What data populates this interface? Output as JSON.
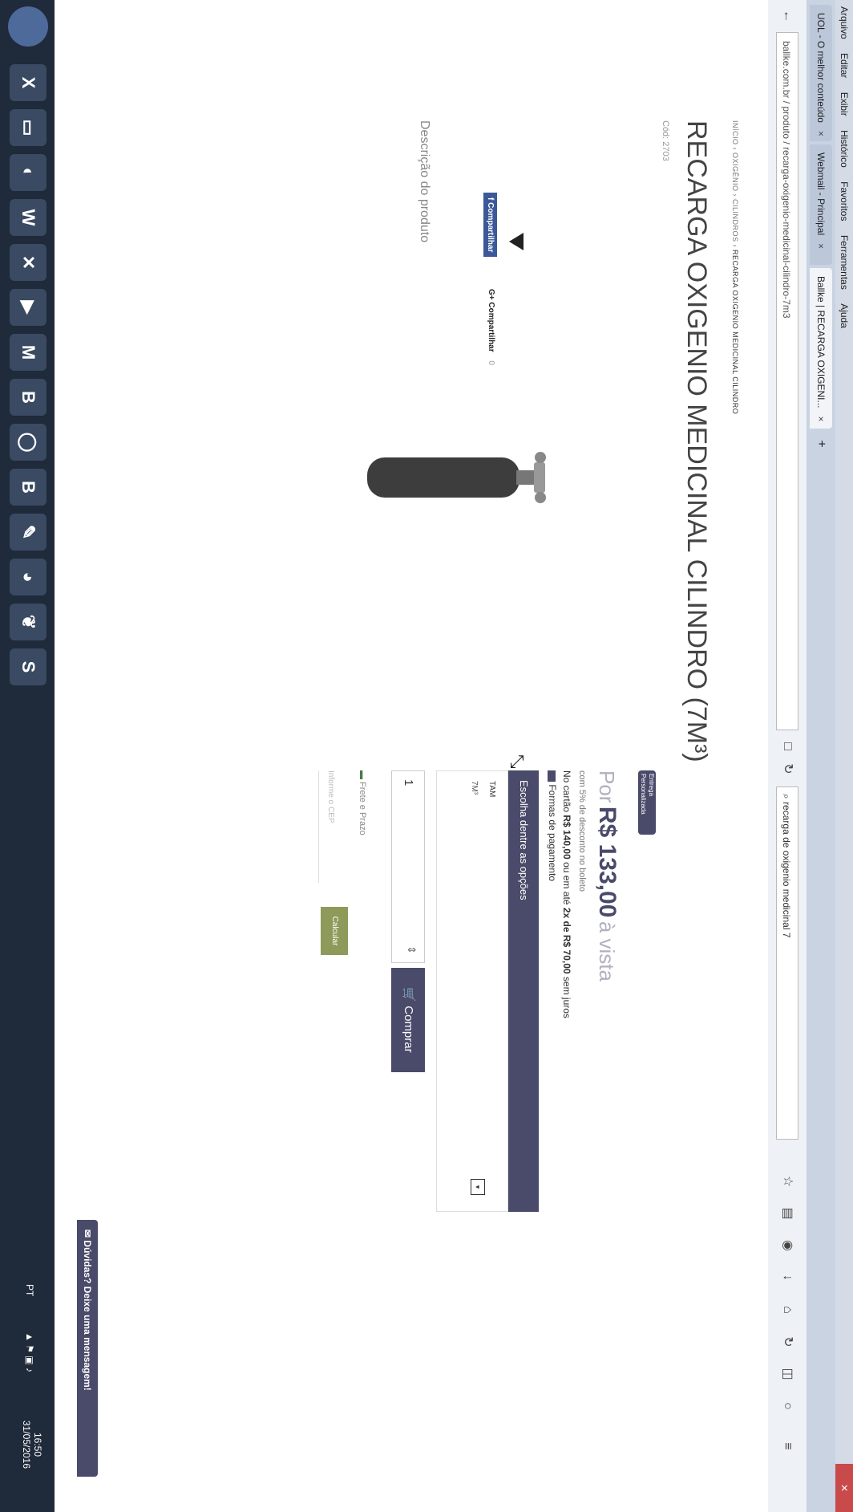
{
  "browser": {
    "menu": [
      "Arquivo",
      "Editar",
      "Exibir",
      "Histórico",
      "Favoritos",
      "Ferramentas",
      "Ajuda"
    ],
    "tabs": [
      {
        "label": "UOL - O melhor conteúdo"
      },
      {
        "label": "Webmail - Principal"
      },
      {
        "label": "Ballke | RECARGA OXIGENI..."
      }
    ],
    "url": "ballke.com.br / produto / recarga-oxigenio-medicinal-cilindro-7m3",
    "search_value": "recarga de oxigenio medicinal 7"
  },
  "breadcrumb": [
    "INÍCIO",
    "OXIGÊNIO",
    "CILINDROS",
    "RECARGA OXIGENIO MEDICINAL CILINDRO"
  ],
  "product": {
    "title": "RECARGA OXIGENIO MEDICINAL CILINDRO (7M³)",
    "code": "Cód: 2703",
    "badge_top": "Entrega",
    "badge_bottom": "Personalizada",
    "price_prefix": "Por",
    "price": "R$ 133,00",
    "price_suffix": "à vista",
    "discount_note": "com 5% de desconto no boleto",
    "card_prefix": "No cartão",
    "card_price": "R$ 140,00",
    "card_mid": "ou em até",
    "installments": "2x de R$ 70,00",
    "card_suffix": "sem juros",
    "payment_link": "Formas de pagamento"
  },
  "options": {
    "header": "Escolha dentre as opções",
    "label": "TAM",
    "value": "7M³"
  },
  "quantity": "1",
  "buy_label": "Comprar",
  "freight": {
    "label": "Frete e Prazo",
    "cep_label": "Informe o CEP",
    "calc_label": "Calcular"
  },
  "share": {
    "fb_label": "Compartilhar",
    "g_label": "G+ Compartilhar",
    "g_count": "0"
  },
  "description_title": "Descrição do produto",
  "chat_label": "Dúvidas? Deixe uma mensagem!",
  "system": {
    "lang": "PT",
    "time": "16:50",
    "date": "31/05/2016"
  },
  "colors": {
    "accent": "#4a4a6a",
    "buy_button": "#4a4a6a",
    "calc_button": "#8e9a5a",
    "price_text": "#b0b0c0"
  }
}
